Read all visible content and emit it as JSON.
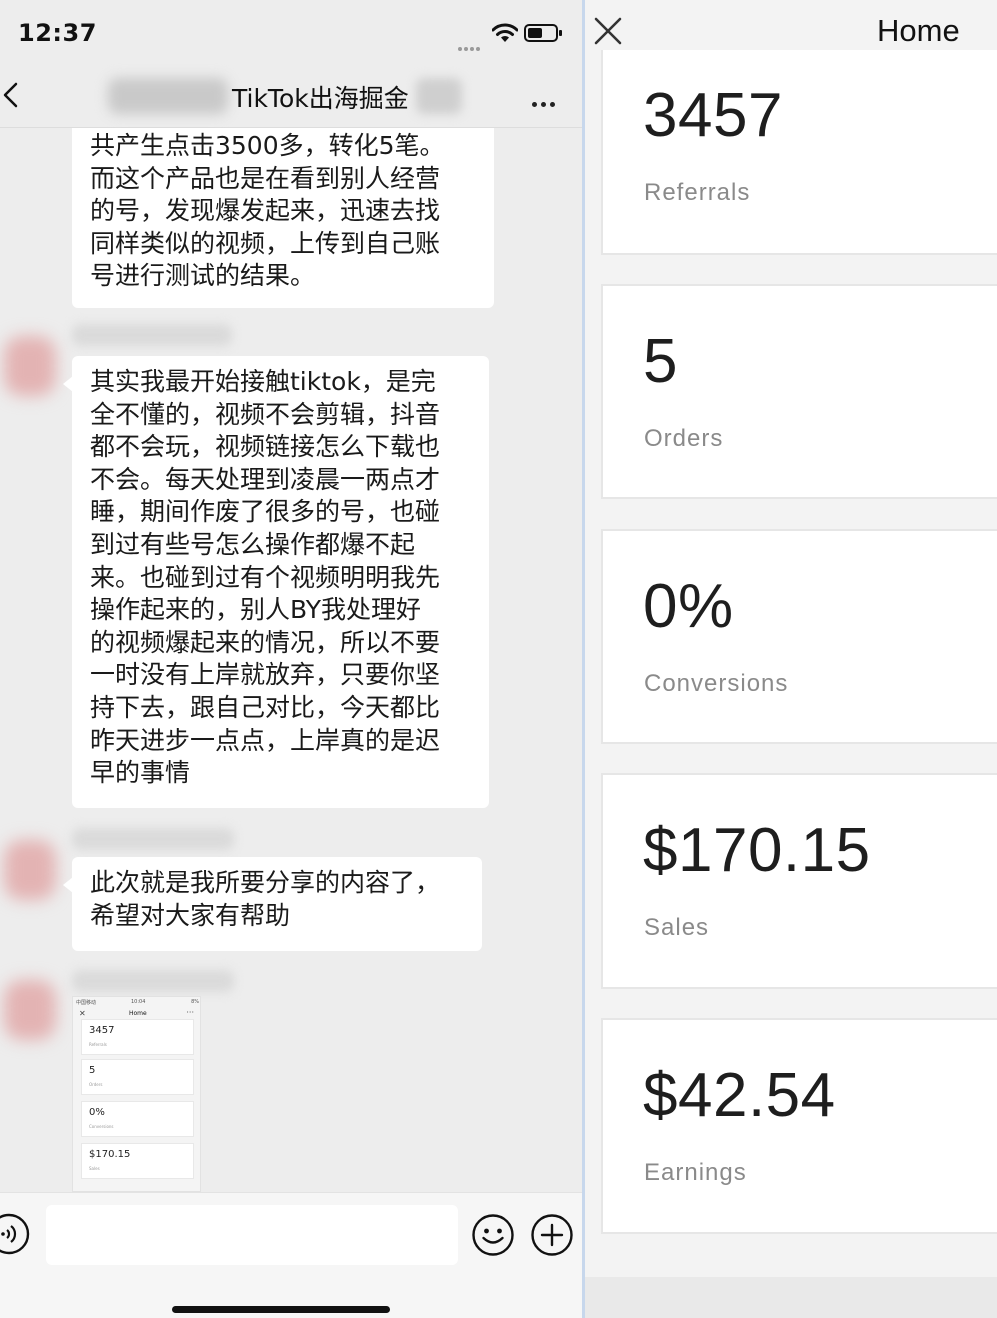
{
  "status_bar": {
    "time": "12:37"
  },
  "chat": {
    "title": "TikTok出海掘金",
    "messages": [
      {
        "text": "共产生点击3500多，转化5笔。\n而这个产品也是在看到别人经营\n的号，发现爆发起来，迅速去找\n同样类似的视频，上传到自己账\n号进行测试的结果。"
      },
      {
        "text": "其实我最开始接触tiktok，是完\n全不懂的，视频不会剪辑，抖音\n都不会玩，视频链接怎么下载也\n不会。每天处理到凌晨一两点才\n睡，期间作废了很多的号，也碰\n到过有些号怎么操作都爆不起\n来。也碰到过有个视频明明我先\n操作起来的，别人BY我处理好\n的视频爆起来的情况，所以不要\n一时没有上岸就放弃，只要你坚\n持下去，跟自己对比，今天都比\n昨天进步一点点，上岸真的是迟\n早的事情"
      },
      {
        "text": "此次就是我所要分享的内容了，\n希望对大家有帮助"
      }
    ],
    "thumbnail": {
      "carrier": "中国移动",
      "time": "10:04",
      "battery": "8%",
      "close": "✕",
      "title": "Home",
      "more": "···",
      "cards": [
        {
          "value": "3457",
          "label": "Referrals"
        },
        {
          "value": "5",
          "label": "Orders"
        },
        {
          "value": "0%",
          "label": "Conversions"
        },
        {
          "value": "$170.15",
          "label": "Sales"
        }
      ]
    },
    "input": {
      "placeholder": "",
      "value": ""
    }
  },
  "dashboard": {
    "title": "Home",
    "stats": [
      {
        "value": "3457",
        "label": "Referrals"
      },
      {
        "value": "5",
        "label": "Orders"
      },
      {
        "value": "0%",
        "label": "Conversions"
      },
      {
        "value": "$170.15",
        "label": "Sales"
      },
      {
        "value": "$42.54",
        "label": "Earnings"
      }
    ]
  }
}
